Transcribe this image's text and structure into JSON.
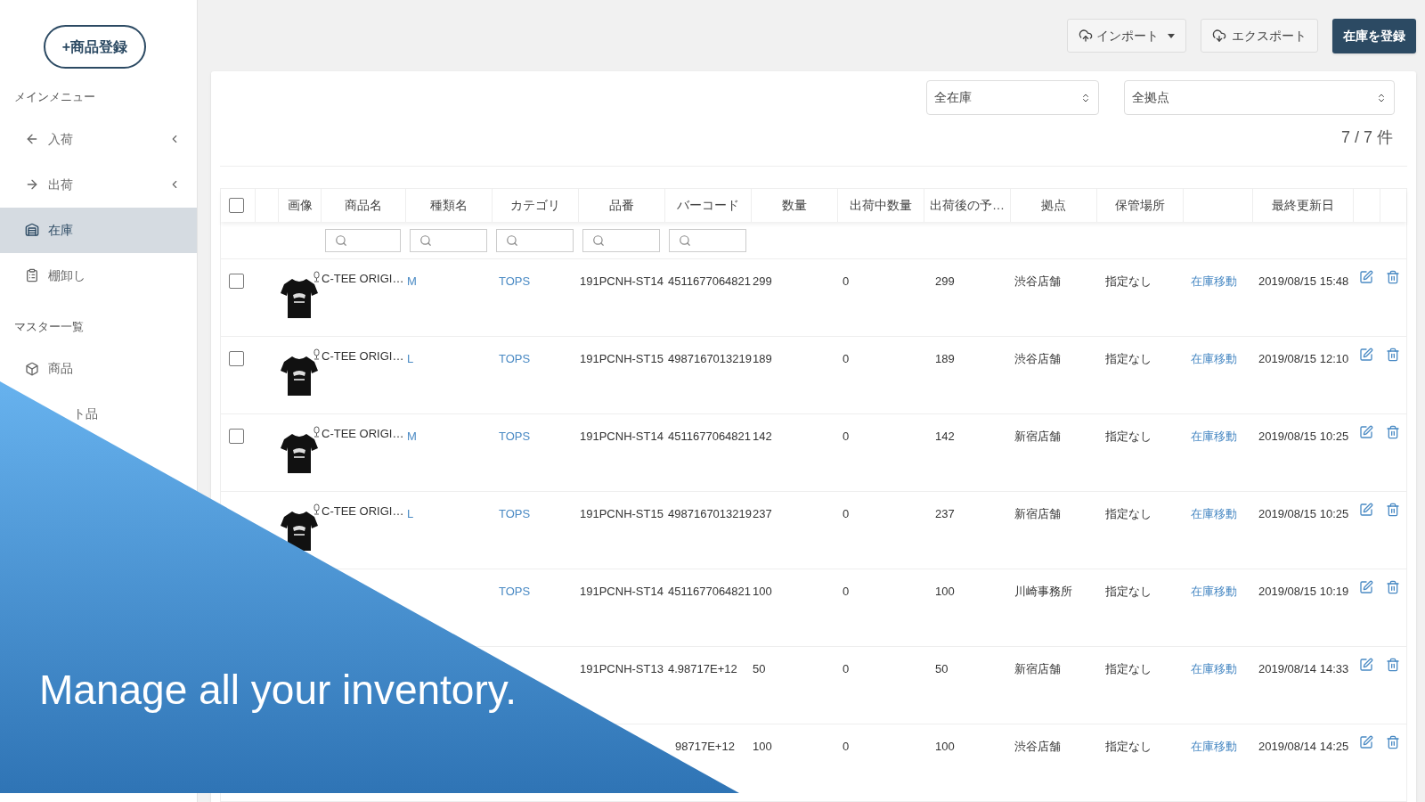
{
  "sidebar": {
    "register_button": "+商品登録",
    "sections": [
      {
        "heading": "メインメニュー",
        "items": [
          {
            "label": "入荷",
            "has_submenu": true,
            "selected": false
          },
          {
            "label": "出荷",
            "has_submenu": true,
            "selected": false
          },
          {
            "label": "在庫",
            "has_submenu": false,
            "selected": true
          },
          {
            "label": "棚卸し",
            "has_submenu": false,
            "selected": false
          }
        ]
      },
      {
        "heading": "マスター一覧",
        "items": [
          {
            "label": "商品",
            "has_submenu": false,
            "selected": false
          },
          {
            "label": "ト品",
            "has_submenu": false,
            "selected": false,
            "icon_hidden": true
          }
        ]
      }
    ]
  },
  "toolbar": {
    "import_button": "インポート",
    "export_button": "エクスポート",
    "register_button": "在庫を登録"
  },
  "filters": {
    "stock_select": "全在庫",
    "site_select": "全拠点",
    "count": "7 / 7 件"
  },
  "table": {
    "select_all_checked": false,
    "columns": [
      "画像",
      "商品名",
      "種類名",
      "カテゴリ",
      "品番",
      "バーコード",
      "数量",
      "出荷中数量",
      "出荷後の予…",
      "拠点",
      "保管場所",
      "最終更新日"
    ],
    "rows": [
      {
        "checked": false,
        "has_image": true,
        "name": "C-TEE ORIGI…",
        "variant": "M",
        "category": "TOPS",
        "code": "191PCNH-ST14",
        "barcode": "4511677064821",
        "qty": "299",
        "shipping": "0",
        "after": "299",
        "site": "渋谷店舗",
        "location": "指定なし",
        "action": "在庫移動",
        "updated": "2019/08/15 15:48"
      },
      {
        "checked": false,
        "has_image": true,
        "name": "C-TEE ORIGI…",
        "variant": "L",
        "category": "TOPS",
        "code": "191PCNH-ST15",
        "barcode": "4987167013219",
        "qty": "189",
        "shipping": "0",
        "after": "189",
        "site": "渋谷店舗",
        "location": "指定なし",
        "action": "在庫移動",
        "updated": "2019/08/15 12:10"
      },
      {
        "checked": false,
        "has_image": true,
        "name": "C-TEE ORIGI…",
        "variant": "M",
        "category": "TOPS",
        "code": "191PCNH-ST14",
        "barcode": "4511677064821",
        "qty": "142",
        "shipping": "0",
        "after": "142",
        "site": "新宿店舗",
        "location": "指定なし",
        "action": "在庫移動",
        "updated": "2019/08/15 10:25"
      },
      {
        "has_image": true,
        "name": "C-TEE ORIGI…",
        "variant": "L",
        "category": "TOPS",
        "code": "191PCNH-ST15",
        "barcode": "4987167013219",
        "qty": "237",
        "shipping": "0",
        "after": "237",
        "site": "新宿店舗",
        "location": "指定なし",
        "action": "在庫移動",
        "updated": "2019/08/15 10:25"
      },
      {
        "category": "TOPS",
        "code": "191PCNH-ST14",
        "barcode": "4511677064821",
        "qty": "100",
        "shipping": "0",
        "after": "100",
        "site": "川崎事務所",
        "location": "指定なし",
        "action": "在庫移動",
        "updated": "2019/08/15 10:19"
      },
      {
        "code": "191PCNH-ST13",
        "barcode": "4.98717E+12",
        "qty": "50",
        "shipping": "0",
        "after": "50",
        "site": "新宿店舗",
        "location": "指定なし",
        "action": "在庫移動",
        "updated": "2019/08/14 14:33"
      },
      {
        "barcode": "98717E+12",
        "qty": "100",
        "shipping": "0",
        "after": "100",
        "site": "渋谷店舗",
        "location": "指定なし",
        "action": "在庫移動",
        "updated": "2019/08/14 14:25"
      }
    ]
  },
  "overlay": {
    "caption": "Manage all your inventory."
  }
}
